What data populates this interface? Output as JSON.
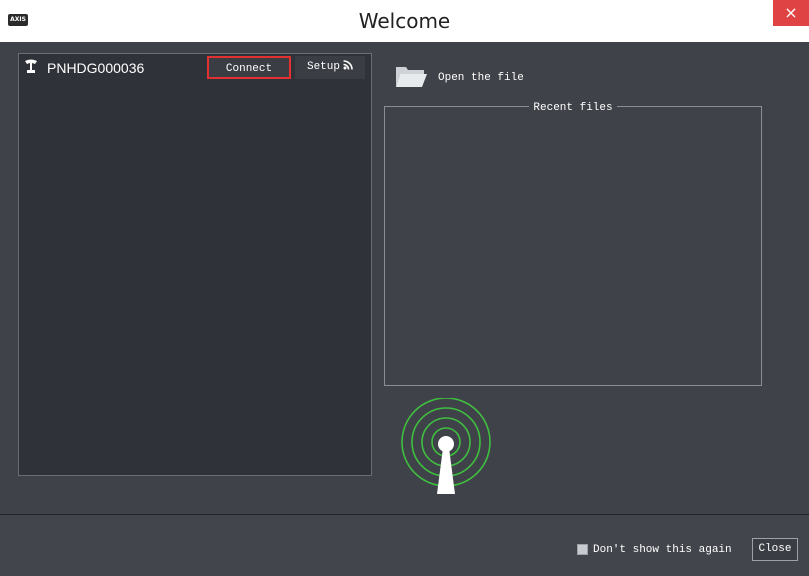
{
  "window": {
    "title": "Welcome",
    "app_badge": "AXIS",
    "close_glyph": "×"
  },
  "devices": {
    "items": [
      {
        "name": "PNHDG000036",
        "icon": "radar-icon",
        "connect_label": "Connect",
        "setup_label": "Setup"
      }
    ]
  },
  "files": {
    "open_label": "Open the file",
    "recent_label": "Recent files"
  },
  "footer": {
    "dont_show_label": "Don't show this again",
    "close_label": "Close"
  },
  "colors": {
    "highlight": "#e23131",
    "signal": "#3fbf3f",
    "close": "#e04343"
  }
}
